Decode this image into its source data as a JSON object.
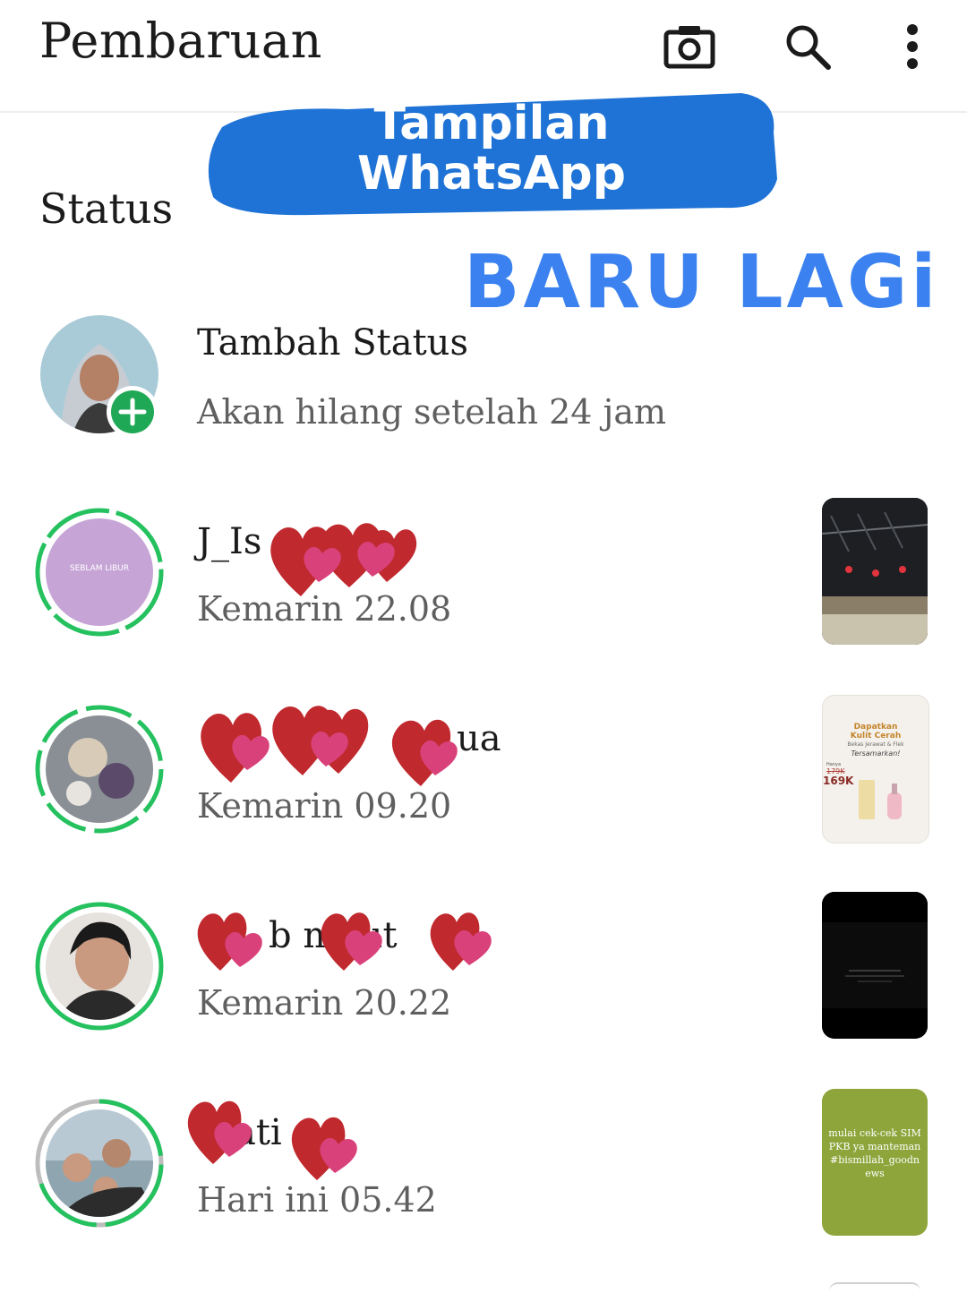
{
  "header": {
    "title": "Pembaruan",
    "icons": [
      "camera-icon",
      "search-icon",
      "more-vert-icon"
    ]
  },
  "section": {
    "title": "Status"
  },
  "overlay": {
    "line1": "Tampilan",
    "line2": "WhatsApp",
    "subtitle": "BARU LAGi",
    "brush_color": "#1f73d6",
    "subtitle_color": "#3b82f0"
  },
  "my_status": {
    "name": "Tambah Status",
    "subtitle": "Akan hilang setelah 24 jam",
    "add_color": "#1fa855"
  },
  "statuses": [
    {
      "name": "J_Is",
      "time": "Kemarin 22.08",
      "avatar_text": "SEBLAM LIBUR",
      "ring": "unseen"
    },
    {
      "name": "ua",
      "time": "Kemarin 09.20",
      "ring": "unseen"
    },
    {
      "name": "b mi ut",
      "time": "Kemarin 20.22",
      "ring": "unseen"
    },
    {
      "name": "ati",
      "time": "Hari ini 05.42",
      "ring": "partially-seen"
    }
  ],
  "thumbnails": {
    "t2": {
      "line1": "Dapatkan",
      "line2": "Kulit Cerah",
      "line3": "Bekas Jerawat & Flek",
      "line4": "Tersamarkan!",
      "price_old": "179K",
      "price_new": "169K",
      "label": "Hanya"
    },
    "t4": {
      "text": "mulai cek-cek SIMPKB ya manteman #bismillah_goodnews"
    }
  },
  "colors": {
    "ring": "#25c15f",
    "ring_seen": "#bdbdbd",
    "heart_red": "#c0292e",
    "heart_pink": "#d9417a"
  }
}
